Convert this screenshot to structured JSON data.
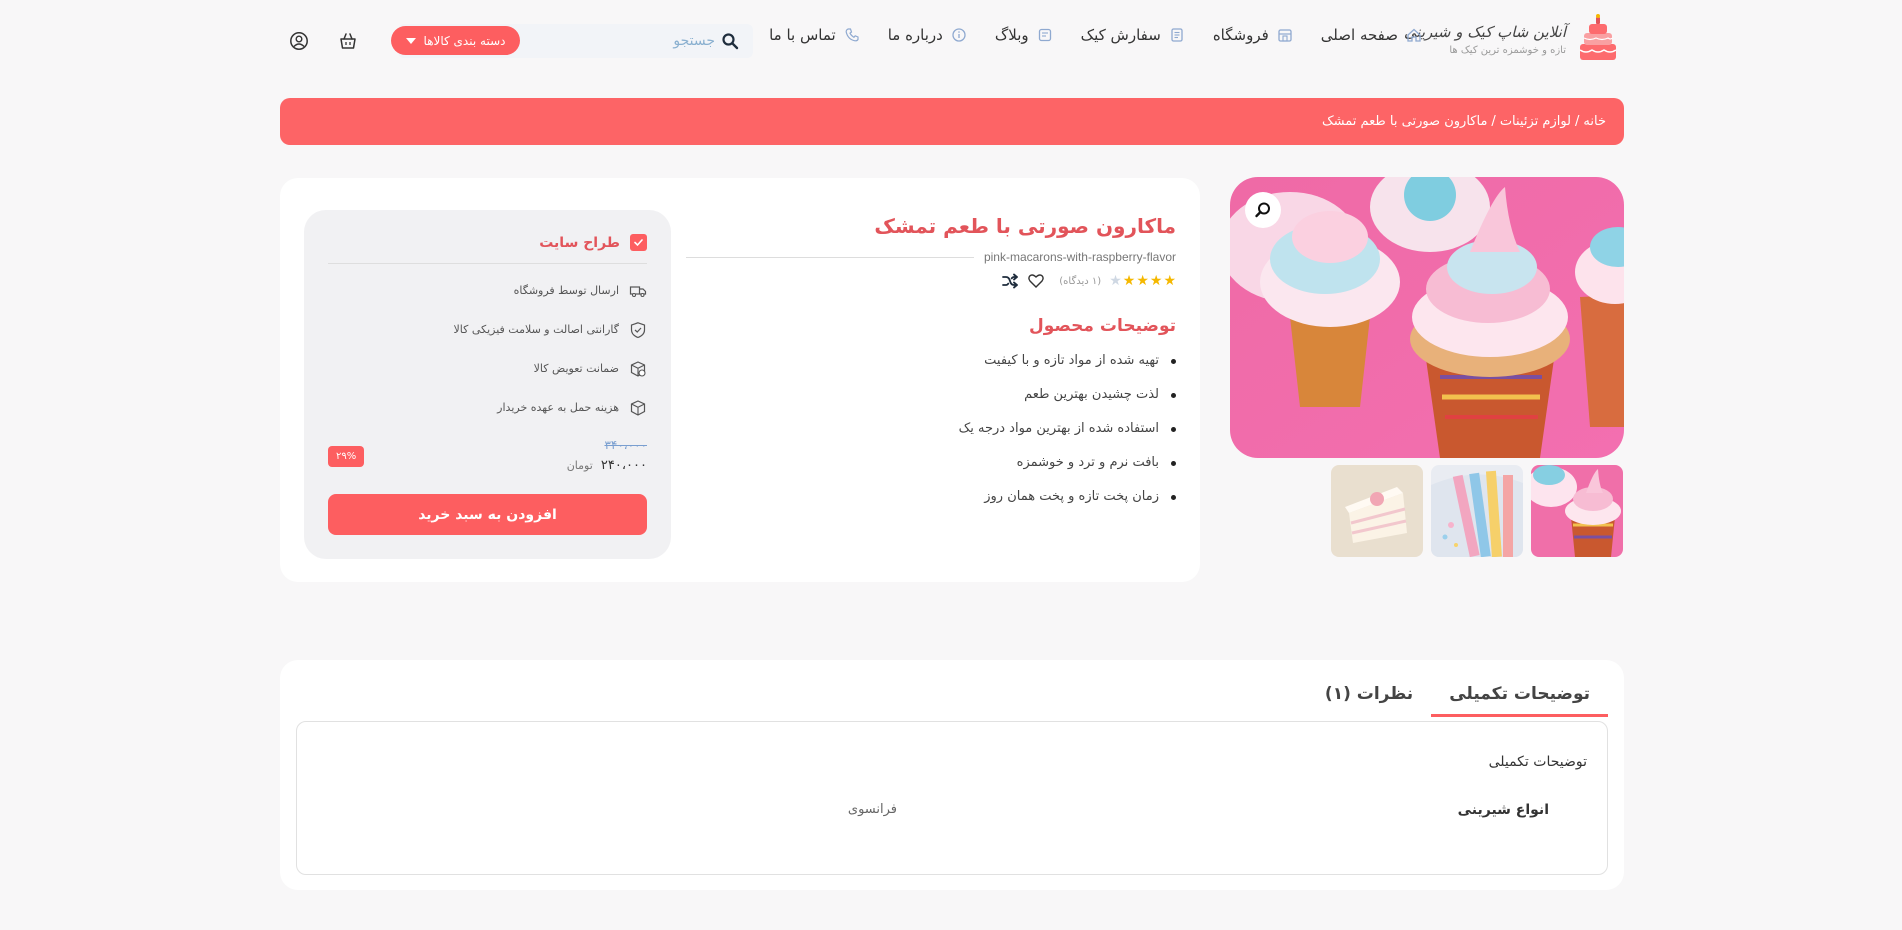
{
  "brand": {
    "name": "آنلاین شاپ کیک و شیرینی",
    "tagline": "تازه و خوشمزه ترین کیک ها"
  },
  "nav": [
    {
      "label": "صفحه اصلی",
      "icon": "home-icon"
    },
    {
      "label": "فروشگاه",
      "icon": "store-icon"
    },
    {
      "label": "سفارش کیک",
      "icon": "order-icon"
    },
    {
      "label": "وبلاگ",
      "icon": "blog-icon"
    },
    {
      "label": "درباره ما",
      "icon": "info-icon"
    },
    {
      "label": "تماس با ما",
      "icon": "phone-icon"
    }
  ],
  "search": {
    "placeholder": "جستجو"
  },
  "category_button": "دسته بندی کالاها",
  "breadcrumb": {
    "home": "خانه",
    "separator": "/",
    "category": "لوازم تزئینات",
    "current": "ماکارون صورتی با طعم تمشک"
  },
  "product": {
    "title": "ماکارون صورتی با طعم تمشک",
    "slug": "pink-macarons-with-raspberry-flavor",
    "rating": 4,
    "rating_max": 5,
    "reviews": "(۱ دیدگاه)",
    "description_title": "توضیحات محصول",
    "description_items": [
      "تهیه شده از مواد تازه و با کیفیت",
      "لذت چشیدن بهترین طعم",
      "استفاده شده از بهترین مواد درجه یک",
      "بافت نرم و ترد و خوشمزه",
      "زمان پخت تازه و پخت همان روز"
    ]
  },
  "buy_box": {
    "seller": "طراح سایت",
    "features": [
      {
        "label": "ارسال توسط فروشگاه",
        "icon": "truck-icon"
      },
      {
        "label": "گارانتی اصالت و سلامت فیزیکی کالا",
        "icon": "shield-icon"
      },
      {
        "label": "ضمانت تعویض کالا",
        "icon": "exchange-icon"
      },
      {
        "label": "هزینه حمل به عهده خریدار",
        "icon": "box-icon"
      }
    ],
    "old_price": "۳۴۰،۰۰۰",
    "new_price": "۲۴۰،۰۰۰",
    "currency": "تومان",
    "discount": "۲۹%",
    "add_to_cart": "افزودن به سبد خرید"
  },
  "tabs": [
    {
      "label": "توضیحات تکمیلی",
      "active": true
    },
    {
      "label": "نظرات (۱)",
      "active": false
    }
  ],
  "additional_info": {
    "title": "توضیحات تکمیلی",
    "attribute": "انواع شیرینی",
    "value": "فرانسوی"
  },
  "colors": {
    "accent": "#fd5e60",
    "title": "#e2545a",
    "background": "#f8f7f8"
  }
}
